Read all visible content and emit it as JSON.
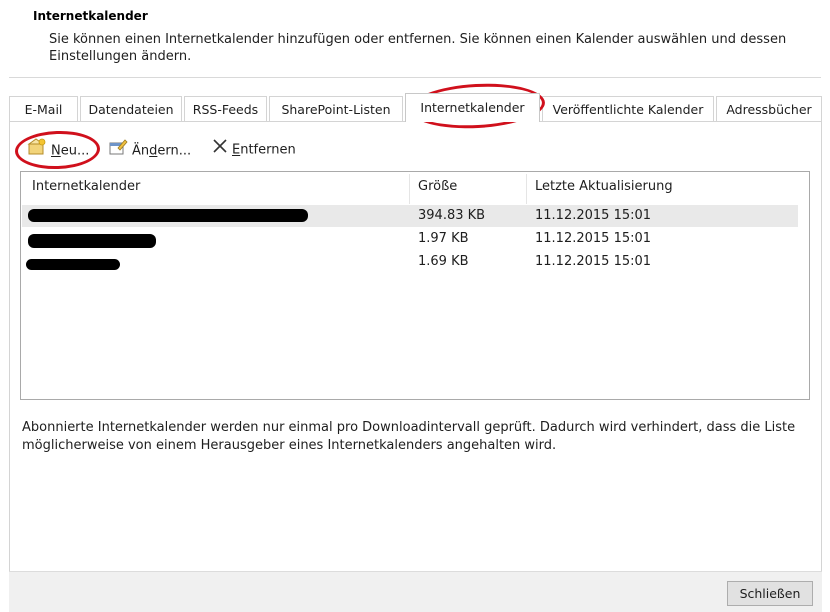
{
  "header": {
    "title": "Internetkalender",
    "description": "Sie können einen Internetkalender hinzufügen oder entfernen. Sie können einen Kalender auswählen und dessen Einstellungen ändern."
  },
  "tabs": [
    {
      "label": "E-Mail"
    },
    {
      "label": "Datendateien"
    },
    {
      "label": "RSS-Feeds"
    },
    {
      "label": "SharePoint-Listen"
    },
    {
      "label": "Internetkalender",
      "active": true
    },
    {
      "label": "Veröffentlichte Kalender"
    },
    {
      "label": "Adressbücher"
    }
  ],
  "toolbar": {
    "new": {
      "pre": "",
      "accel": "N",
      "post": "eu...",
      "icon": "new-calendar-icon"
    },
    "change": {
      "pre": "Än",
      "accel": "d",
      "post": "ern...",
      "icon": "change-settings-icon"
    },
    "remove": {
      "pre": "",
      "accel": "E",
      "post": "ntfernen",
      "icon": "close-x-icon"
    }
  },
  "list": {
    "columns": [
      "Internetkalender",
      "Größe",
      "Letzte Aktualisierung"
    ],
    "rows": [
      {
        "name": "",
        "size": "394.83 KB",
        "updated": "11.12.2015 15:01",
        "selected": true
      },
      {
        "name": "",
        "size": "1.97 KB",
        "updated": "11.12.2015 15:01"
      },
      {
        "name": "",
        "size": "1.69 KB",
        "updated": "11.12.2015 15:01"
      }
    ]
  },
  "footer": {
    "info": "Abonnierte Internetkalender werden nur einmal pro Downloadintervall geprüft. Dadurch wird verhindert, dass die Liste möglicherweise von einem Herausgeber eines Internetkalenders angehalten wird."
  },
  "close_button": "Schließen",
  "colors": {
    "annotation": "#d0101c",
    "selection": "#e9e9e9",
    "button_face": "#e1e1e1"
  }
}
